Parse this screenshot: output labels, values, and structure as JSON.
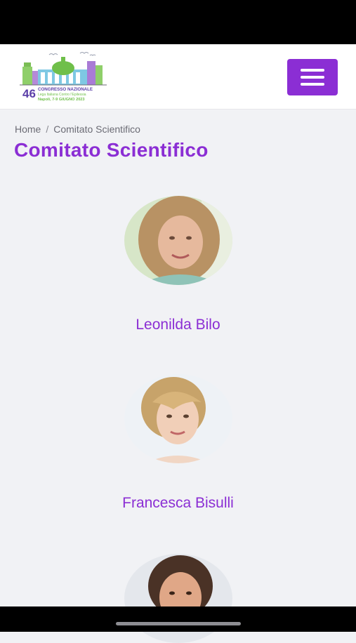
{
  "header": {
    "logo": {
      "edition": "46",
      "line1": "CONGRESSO NAZIONALE",
      "line2": "Lega Italiana Contro l'Epilessia",
      "line3": "Napoli, 7-9 GIUGNO 2023"
    },
    "menu_icon": "hamburger-menu-icon",
    "accent_color": "#8b2ed4"
  },
  "breadcrumb": {
    "home": "Home",
    "separator": "/",
    "current": "Comitato Scientifico"
  },
  "page_title": "Comitato Scientifico",
  "members": [
    {
      "name": "Leonilda Bilo"
    },
    {
      "name": "Francesca Bisulli"
    },
    {
      "name": ""
    }
  ]
}
